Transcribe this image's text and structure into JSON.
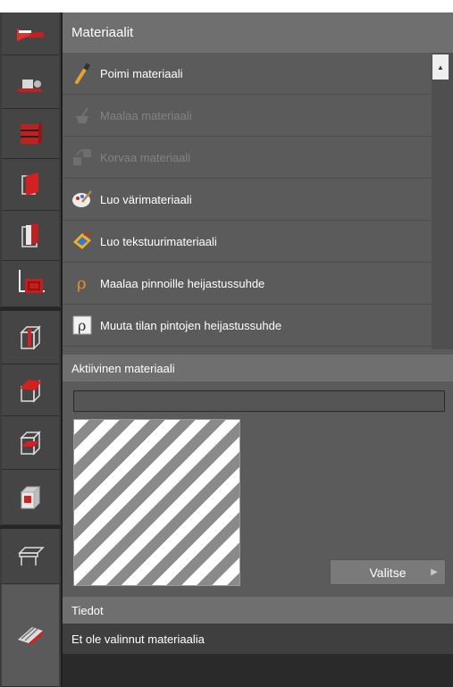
{
  "panel": {
    "title": "Materiaalit",
    "menu": [
      {
        "label": "Poimi materiaali",
        "icon": "eyedropper-icon",
        "enabled": true
      },
      {
        "label": "Maalaa materiaali",
        "icon": "paint-bucket-icon",
        "enabled": false
      },
      {
        "label": "Korvaa materiaali",
        "icon": "replace-material-icon",
        "enabled": false
      },
      {
        "label": "Luo värimateriaali",
        "icon": "color-palette-icon",
        "enabled": true
      },
      {
        "label": "Luo tekstuurimateriaali",
        "icon": "texture-icon",
        "enabled": true
      },
      {
        "label": "Maalaa pinnoille heijastussuhde",
        "icon": "reflectance-paint-icon",
        "enabled": true
      },
      {
        "label": "Muuta tilan pintojen heijastussuhde",
        "icon": "reflectance-room-icon",
        "enabled": true
      }
    ]
  },
  "active_material": {
    "title": "Aktiivinen materiaali",
    "name_value": "",
    "choose_label": "Valitse"
  },
  "info": {
    "title": "Tiedot",
    "message": "Et ole valinnut materiaalia"
  },
  "toolbar": {
    "tools": [
      {
        "name": "tool-arrow-icon"
      },
      {
        "name": "tool-furniture-icon"
      },
      {
        "name": "tool-shelf-icon"
      },
      {
        "name": "tool-wall-icon"
      },
      {
        "name": "tool-door-icon"
      },
      {
        "name": "tool-room-icon"
      },
      {
        "name": "tool-cube-column-icon"
      },
      {
        "name": "tool-cube-roof-icon"
      },
      {
        "name": "tool-cube-slab-icon"
      },
      {
        "name": "tool-cube-window-icon"
      },
      {
        "name": "tool-table-icon"
      },
      {
        "name": "tool-material-icon"
      }
    ]
  },
  "colors": {
    "accent_red": "#d42020",
    "panel_bg": "#5b5b5b",
    "title_bg": "#6f6f6f"
  }
}
